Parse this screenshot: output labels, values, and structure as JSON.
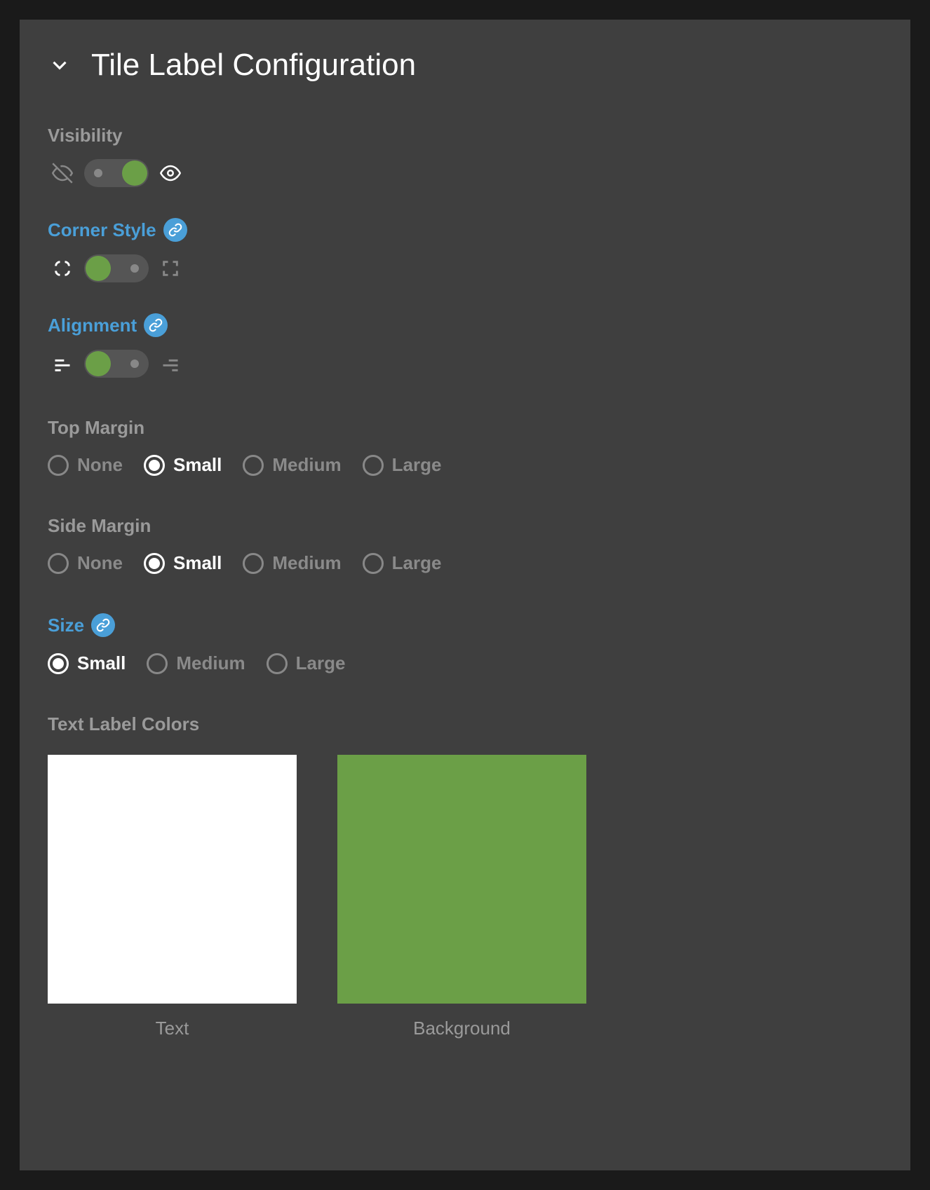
{
  "title": "Tile Label Configuration",
  "visibility": {
    "label": "Visibility",
    "linked": false,
    "toggle_on": true
  },
  "corner_style": {
    "label": "Corner Style",
    "linked": true,
    "toggle_on": false
  },
  "alignment": {
    "label": "Alignment",
    "linked": true,
    "toggle_on": false
  },
  "top_margin": {
    "label": "Top Margin",
    "options": [
      "None",
      "Small",
      "Medium",
      "Large"
    ],
    "selected": "Small"
  },
  "side_margin": {
    "label": "Side Margin",
    "options": [
      "None",
      "Small",
      "Medium",
      "Large"
    ],
    "selected": "Small"
  },
  "size": {
    "label": "Size",
    "linked": true,
    "options": [
      "Small",
      "Medium",
      "Large"
    ],
    "selected": "Small"
  },
  "colors": {
    "label": "Text Label Colors",
    "swatches": [
      {
        "label": "Text",
        "color": "#ffffff"
      },
      {
        "label": "Background",
        "color": "#6b9f47"
      }
    ]
  }
}
